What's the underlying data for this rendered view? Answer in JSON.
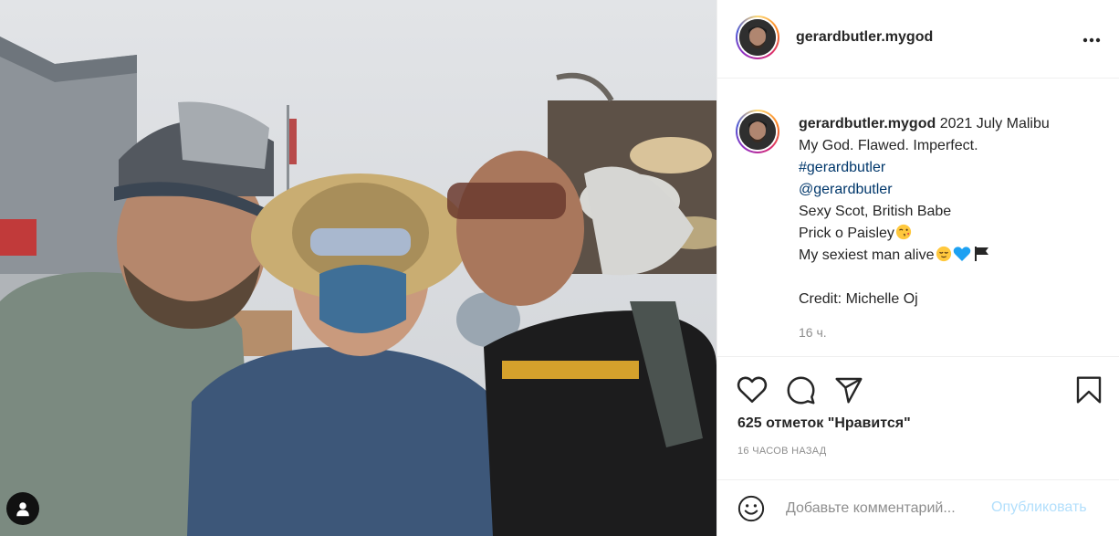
{
  "post": {
    "username": "gerardbutler.mygod",
    "more_icon": "more-horizontal-icon",
    "caption": {
      "title_text": "2021 July Malibu",
      "line1": "My God. Flawed. Imperfect.",
      "hashtag": "#gerardbutler",
      "mention": "@gerardbutler",
      "line2": "Sexy Scot, British Babe",
      "line3": "Prick o Paisley",
      "line4": "My sexiest man alive",
      "credit": "Credit: Michelle Oj"
    },
    "caption_time": "16 ч.",
    "likes": "625 отметок \"Нравится\"",
    "date": "16 ЧАСОВ НАЗАД",
    "comment_placeholder": "Добавьте комментарий...",
    "publish_label": "Опубликовать",
    "icons": [
      "heart-icon",
      "comment-icon",
      "share-icon",
      "bookmark-icon",
      "emoji-icon",
      "user-tag-icon"
    ],
    "colors": {
      "link": "#00376b",
      "publish": "#b2dffc",
      "muted": "#8e8e8e"
    }
  }
}
